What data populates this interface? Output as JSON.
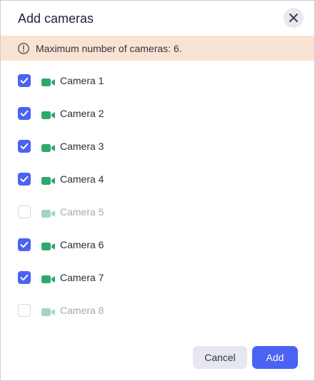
{
  "dialog": {
    "title": "Add cameras",
    "close_icon": "close-icon",
    "notice": {
      "icon": "info-circle-icon",
      "text": "Maximum number of cameras: 6."
    },
    "cameras": [
      {
        "label": "Camera 1",
        "checked": true,
        "disabled": false,
        "icon": "video-camera-icon"
      },
      {
        "label": "Camera 2",
        "checked": true,
        "disabled": false,
        "icon": "video-camera-icon"
      },
      {
        "label": "Camera 3",
        "checked": true,
        "disabled": false,
        "icon": "video-camera-icon"
      },
      {
        "label": "Camera 4",
        "checked": true,
        "disabled": false,
        "icon": "video-camera-icon"
      },
      {
        "label": "Camera 5",
        "checked": false,
        "disabled": true,
        "icon": "video-camera-icon"
      },
      {
        "label": "Camera 6",
        "checked": true,
        "disabled": false,
        "icon": "video-camera-icon"
      },
      {
        "label": "Camera 7",
        "checked": true,
        "disabled": false,
        "icon": "video-camera-icon"
      },
      {
        "label": "Camera 8",
        "checked": false,
        "disabled": true,
        "icon": "video-camera-icon"
      }
    ],
    "buttons": {
      "cancel_label": "Cancel",
      "add_label": "Add"
    }
  },
  "colors": {
    "accent": "#4a63f3",
    "notice_bg": "#f9e3d3",
    "camera_icon": "#2fa86f",
    "secondary_button_bg": "#e7e8ef"
  }
}
